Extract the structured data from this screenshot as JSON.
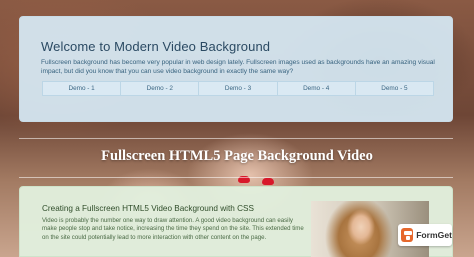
{
  "hero": {
    "title": "Welcome to Modern Video Background",
    "text": "Fullscreen background has become very popular in web design lately. Fullscreen images used as backgrounds have an amazing visual impact, but did you know that you can use video background in exactly the same way?",
    "demos": [
      "Demo - 1",
      "Demo - 2",
      "Demo - 3",
      "Demo - 4",
      "Demo - 5"
    ]
  },
  "headline": "Fullscreen HTML5 Page Background Video",
  "content": {
    "title": "Creating a Fullscreen HTML5 Video Background with CSS",
    "text": "Video is probably the number one way to draw attention. A good video background can easily make people stop and take notice, increasing the time they spend on the site. This extended time on the site could potentially lead to more interaction with other content on the page."
  },
  "brand": {
    "name": "FormGet",
    "icon": "formget-logo-icon",
    "accent": "#e6682d"
  }
}
